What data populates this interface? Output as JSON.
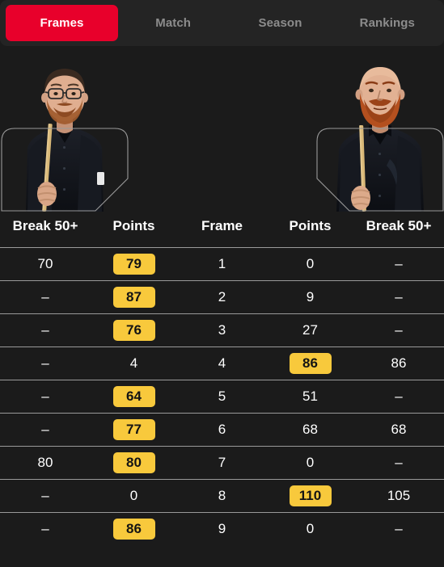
{
  "theme": {
    "background": "#1b1b1b",
    "tabbar_background": "#242424",
    "active_tab_color": "#e8002b",
    "badge_color": "#f8c93c",
    "inactive_tab_text": "#8c8c8c",
    "separator_color": "#9a9a9a"
  },
  "tabs": [
    {
      "label": "Frames",
      "active": true
    },
    {
      "label": "Match",
      "active": false
    },
    {
      "label": "Season",
      "active": false
    },
    {
      "label": "Rankings",
      "active": false
    }
  ],
  "players": [
    {
      "side": "left",
      "icon": "player-photo-left"
    },
    {
      "side": "right",
      "icon": "player-photo-right"
    }
  ],
  "table": {
    "headers": [
      "Break 50+",
      "Points",
      "Frame",
      "Points",
      "Break 50+"
    ],
    "rows": [
      {
        "break_left": "70",
        "points_left": "79",
        "points_left_winner": true,
        "frame": "1",
        "points_right": "0",
        "points_right_winner": false,
        "break_right": "–"
      },
      {
        "break_left": "–",
        "points_left": "87",
        "points_left_winner": true,
        "frame": "2",
        "points_right": "9",
        "points_right_winner": false,
        "break_right": "–"
      },
      {
        "break_left": "–",
        "points_left": "76",
        "points_left_winner": true,
        "frame": "3",
        "points_right": "27",
        "points_right_winner": false,
        "break_right": "–"
      },
      {
        "break_left": "–",
        "points_left": "4",
        "points_left_winner": false,
        "frame": "4",
        "points_right": "86",
        "points_right_winner": true,
        "break_right": "86"
      },
      {
        "break_left": "–",
        "points_left": "64",
        "points_left_winner": true,
        "frame": "5",
        "points_right": "51",
        "points_right_winner": false,
        "break_right": "–"
      },
      {
        "break_left": "–",
        "points_left": "77",
        "points_left_winner": true,
        "frame": "6",
        "points_right": "68",
        "points_right_winner": false,
        "break_right": "68"
      },
      {
        "break_left": "80",
        "points_left": "80",
        "points_left_winner": true,
        "frame": "7",
        "points_right": "0",
        "points_right_winner": false,
        "break_right": "–"
      },
      {
        "break_left": "–",
        "points_left": "0",
        "points_left_winner": false,
        "frame": "8",
        "points_right": "110",
        "points_right_winner": true,
        "break_right": "105"
      },
      {
        "break_left": "–",
        "points_left": "86",
        "points_left_winner": true,
        "frame": "9",
        "points_right": "0",
        "points_right_winner": false,
        "break_right": "–"
      }
    ]
  }
}
